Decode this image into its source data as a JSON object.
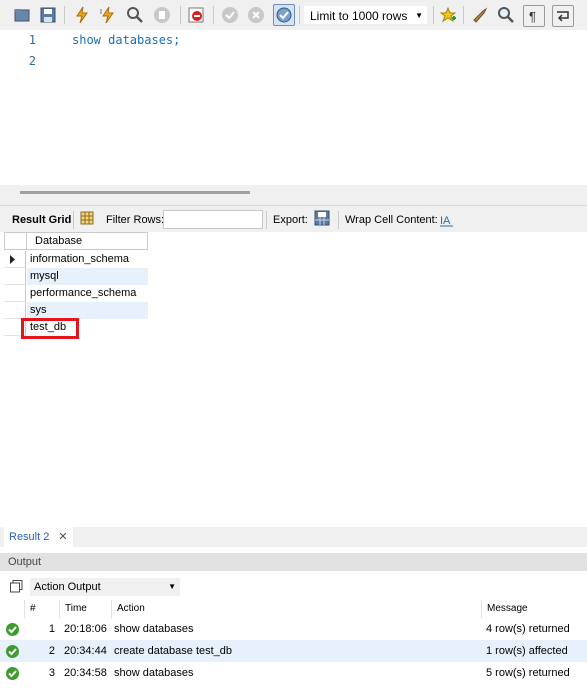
{
  "toolbar": {
    "limit_label": "Limit to 1000 rows",
    "icons": [
      "open-folder-icon",
      "save-icon",
      "execute-icon",
      "execute-current-icon",
      "explain-icon",
      "stop-icon",
      "toggle-error-icon",
      "commit-icon",
      "rollback-icon",
      "autocommit-icon",
      "add-snippet-icon",
      "beautify-icon",
      "find-icon",
      "invisible-chars-icon",
      "wrap-icon"
    ]
  },
  "editor": {
    "lines": [
      {
        "number": "1",
        "code": "show databases;"
      },
      {
        "number": "2",
        "code": ""
      }
    ]
  },
  "result_bar": {
    "result_grid": "Result Grid",
    "filter_rows": "Filter Rows:",
    "export": "Export:",
    "wrap": "Wrap Cell Content:"
  },
  "grid": {
    "column": "Database",
    "rows": [
      "information_schema",
      "mysql",
      "performance_schema",
      "sys",
      "test_db"
    ]
  },
  "tabs": {
    "result2": "Result 2"
  },
  "output": {
    "title": "Output",
    "action_select": "Action Output",
    "headers": {
      "num": "#",
      "time": "Time",
      "action": "Action",
      "message": "Message"
    },
    "rows": [
      {
        "num": "1",
        "time": "20:18:06",
        "action": "show databases",
        "message": "4 row(s) returned"
      },
      {
        "num": "2",
        "time": "20:34:44",
        "action": "create database test_db",
        "message": "1 row(s) affected"
      },
      {
        "num": "3",
        "time": "20:34:58",
        "action": "show databases",
        "message": "5 row(s) returned"
      }
    ]
  },
  "colors": {
    "highlight": "#e4141b",
    "success": "#3f9b2f",
    "keyword": "#1b6fb5"
  }
}
